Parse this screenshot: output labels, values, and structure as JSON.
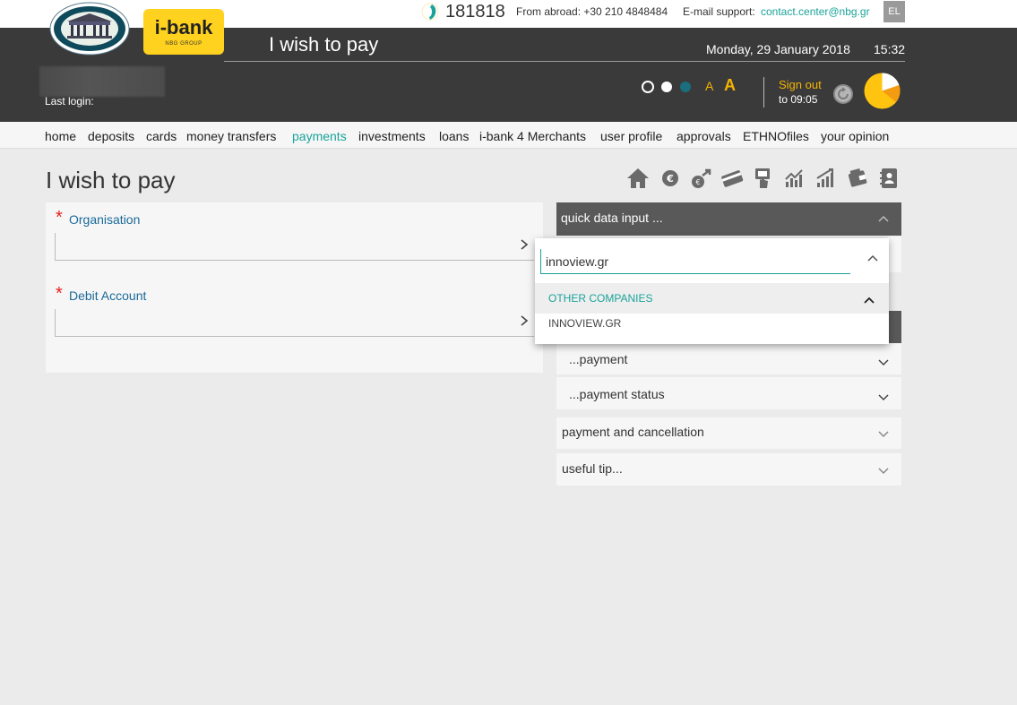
{
  "topbar": {
    "phone": "181818",
    "abroad": "From abroad: +30 210 4848484",
    "email_label": "E-mail support:",
    "email": "contact.center@nbg.gr",
    "lang": "EL"
  },
  "header": {
    "logo_big": "i-bank",
    "logo_small": "NBG GROUP",
    "title": "I wish to pay",
    "date": "Monday, 29 January 2018",
    "time": "15:32",
    "last_login": "Last login:",
    "font_small": "A",
    "font_big": "A",
    "sign_out": "Sign out",
    "sign_out_time": "to 09:05"
  },
  "nav": [
    {
      "label": "home",
      "active": false
    },
    {
      "label": "deposits",
      "active": false
    },
    {
      "label": "cards",
      "active": false
    },
    {
      "label": "money transfers",
      "active": false
    },
    {
      "label": "payments",
      "active": true
    },
    {
      "label": "investments",
      "active": false
    },
    {
      "label": "loans",
      "active": false
    },
    {
      "label": "i-bank 4 Merchants",
      "active": false
    },
    {
      "label": "user profile",
      "active": false
    },
    {
      "label": "approvals",
      "active": false
    },
    {
      "label": "ETHNOfiles",
      "active": false
    },
    {
      "label": "your opinion",
      "active": false
    }
  ],
  "main": {
    "title": "I wish to pay",
    "toolbar_icons": [
      "home-icon",
      "euro-icon",
      "transfer-icon",
      "card-icon",
      "payment-hand-icon",
      "chart-up-icon",
      "chart-growth-icon",
      "wallet-icon",
      "contacts-icon"
    ]
  },
  "form": {
    "star": "*",
    "organisation_label": "Organisation",
    "debit_account_label": "Debit Account"
  },
  "right_panel": {
    "quick_input": "quick data input ...",
    "items": {
      "payment": "...payment",
      "payment_status": "...payment status",
      "payment_cancellation": "payment and cancellation",
      "useful_tip": "useful tip..."
    }
  },
  "dropdown": {
    "search_value": "innoview.gr",
    "group_label": "OTHER COMPANIES",
    "option": "INNOVIEW.GR"
  },
  "colors": {
    "accent": "#1aa39a",
    "header_bg": "#3a3a3a",
    "yellow": "#ffd21f",
    "required": "#e32020"
  }
}
